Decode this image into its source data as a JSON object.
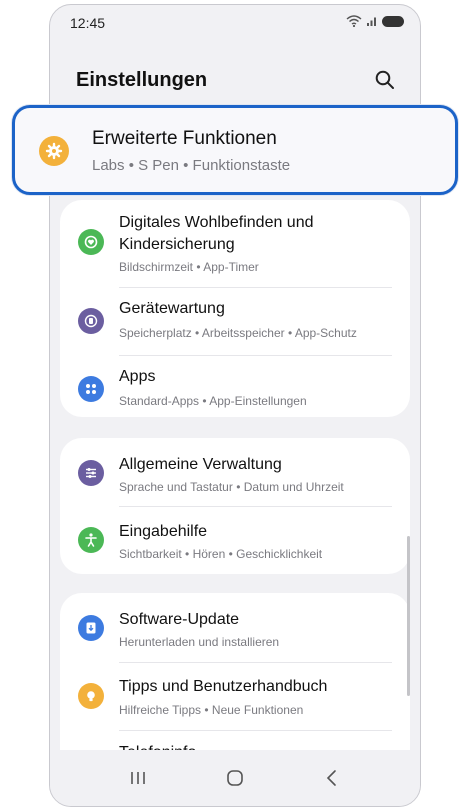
{
  "status_bar": {
    "time": "12:45"
  },
  "header": {
    "title": "Einstellungen"
  },
  "highlighted": {
    "title": "Erweiterte Funktionen",
    "subtitle": "Labs  •  S Pen  •  Funktionstaste",
    "icon": "gear-icon",
    "icon_color": "#f3b13b"
  },
  "group1": [
    {
      "title": "Digitales Wohlbefinden und Kindersicherung",
      "subtitle": "Bildschirmzeit  •  App-Timer",
      "icon": "heart-circle-icon",
      "icon_color": "#4bb856"
    },
    {
      "title": "Gerätewartung",
      "subtitle": "Speicherplatz  •  Arbeitsspeicher  •  App-Schutz",
      "icon": "device-care-icon",
      "icon_color": "#6b5ea0"
    },
    {
      "title": "Apps",
      "subtitle": "Standard-Apps  •  App-Einstellungen",
      "icon": "apps-grid-icon",
      "icon_color": "#3d7be0"
    }
  ],
  "group2": [
    {
      "title": "Allgemeine Verwaltung",
      "subtitle": "Sprache und Tastatur  •  Datum und Uhrzeit",
      "icon": "sliders-icon",
      "icon_color": "#6b5ea0"
    },
    {
      "title": "Eingabehilfe",
      "subtitle": "Sichtbarkeit  •  Hören  •  Geschicklichkeit",
      "icon": "accessibility-icon",
      "icon_color": "#4bb856"
    }
  ],
  "group3": [
    {
      "title": "Software-Update",
      "subtitle": "Herunterladen und installieren",
      "icon": "download-icon",
      "icon_color": "#3d7be0"
    },
    {
      "title": "Tipps und Benutzerhandbuch",
      "subtitle": "Hilfreiche Tipps  •  Neue Funktionen",
      "icon": "lightbulb-icon",
      "icon_color": "#f3b13b"
    },
    {
      "title": "Telefoninfo",
      "subtitle": "",
      "icon": "info-icon",
      "icon_color": "#6b5ea0"
    }
  ]
}
